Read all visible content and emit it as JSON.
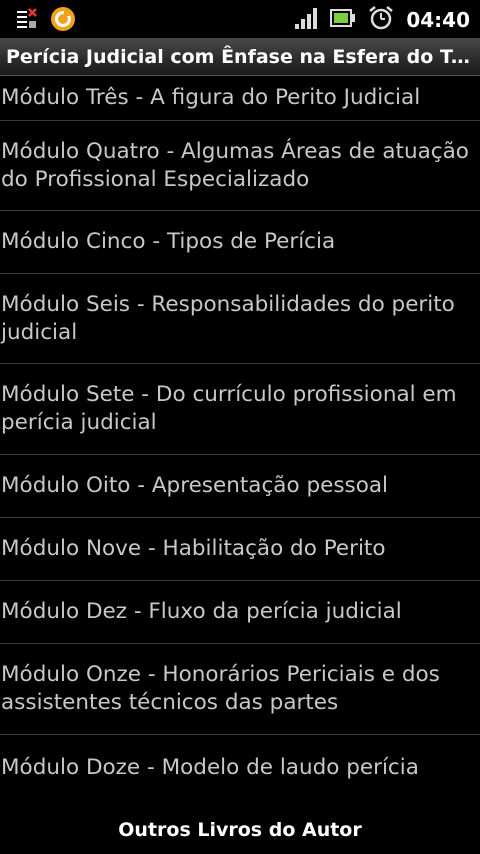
{
  "status_bar": {
    "time": "04:40",
    "icons": [
      "notification-icon",
      "app-icon",
      "signal-icon",
      "battery-icon",
      "alarm-icon"
    ]
  },
  "header": {
    "title": "Perícia Judicial com Ênfase na Esfera do Trab..."
  },
  "list": {
    "items": [
      {
        "label": "Módulo Três - A figura do Perito Judicial"
      },
      {
        "label": "Módulo Quatro - Algumas Áreas de atuação do Profissional Especializado"
      },
      {
        "label": "Módulo Cinco - Tipos de Perícia"
      },
      {
        "label": "Módulo Seis - Responsabilidades do perito judicial"
      },
      {
        "label": "Módulo Sete - Do currículo profissional em perícia judicial"
      },
      {
        "label": "Módulo Oito - Apresentação pessoal"
      },
      {
        "label": "Módulo Nove - Habilitação do Perito"
      },
      {
        "label": "Módulo Dez - Fluxo da perícia judicial"
      },
      {
        "label": "Módulo Onze - Honorários Periciais e dos assistentes técnicos das partes"
      },
      {
        "label": "Módulo Doze - Modelo de laudo perícia"
      }
    ]
  },
  "footer": {
    "label": "Outros Livros do Autor"
  },
  "colors": {
    "background": "#000000",
    "list_text": "#c8c8c8",
    "divider": "#3a3a3a",
    "app_icon": "#f5a11c"
  }
}
